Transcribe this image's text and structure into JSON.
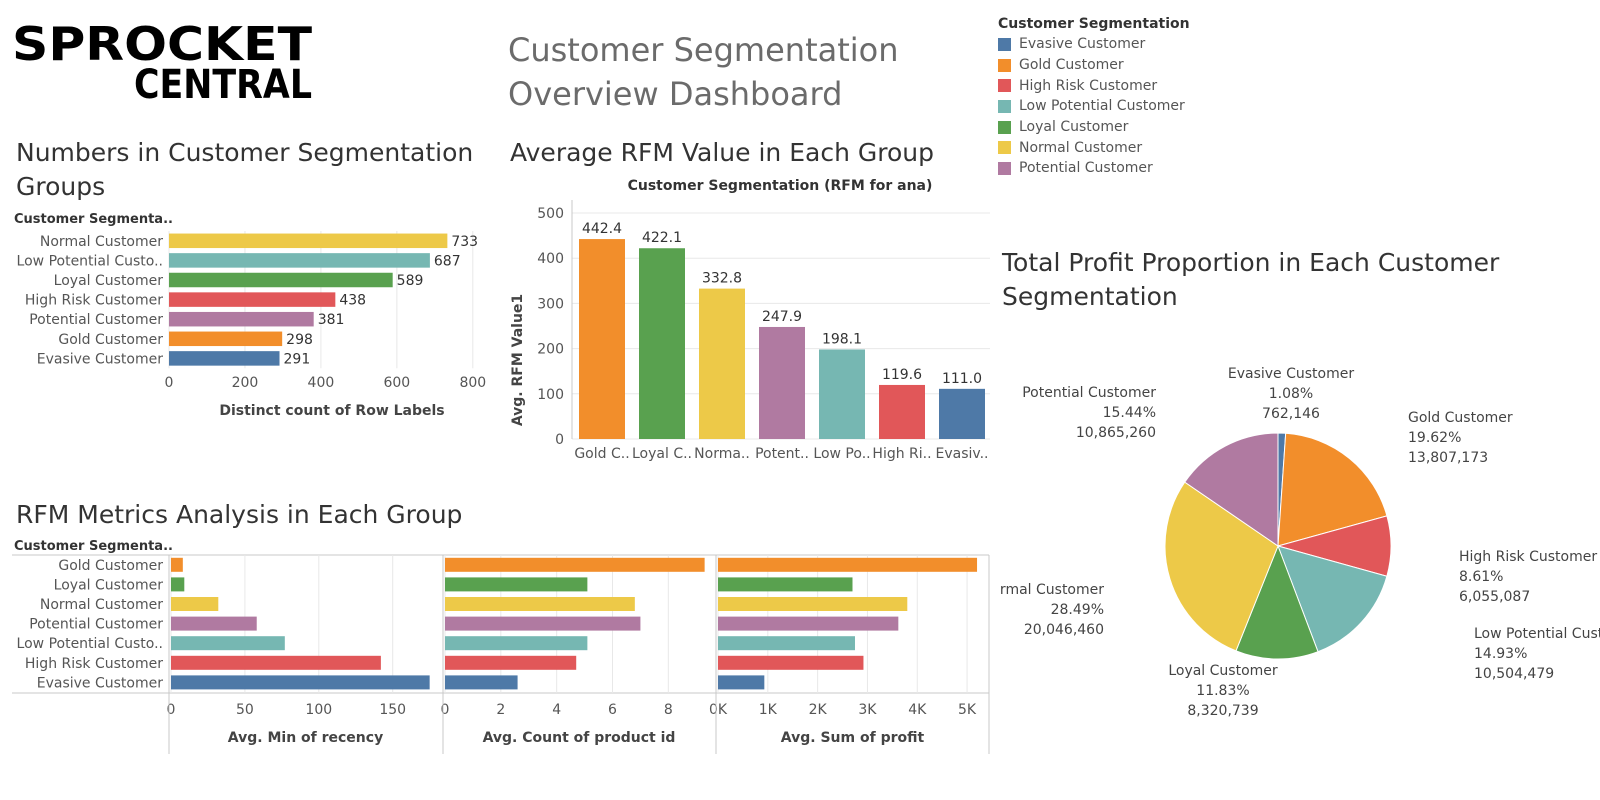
{
  "logo": {
    "line1": "SPROCKET",
    "line2": "CENTRAL"
  },
  "dashboard_title": "Customer Segmentation Overview Dashboard",
  "section_titles": {
    "counts": "Numbers in Customer Segmentation Groups",
    "avg_rfm": "Average RFM Value in Each Group",
    "profit": "Total Profit Proportion in Each Customer Segmentation",
    "metrics": "RFM Metrics Analysis in Each Group"
  },
  "legend": {
    "title": "Customer Segmentation",
    "items": [
      {
        "label": "Evasive Customer",
        "color": "#4e79a7"
      },
      {
        "label": "Gold Customer",
        "color": "#f28e2b"
      },
      {
        "label": "High Risk Customer",
        "color": "#e15759"
      },
      {
        "label": "Low Potential Customer",
        "color": "#76b7b2"
      },
      {
        "label": "Loyal Customer",
        "color": "#59a14f"
      },
      {
        "label": "Normal Customer",
        "color": "#edc948"
      },
      {
        "label": "Potential Customer",
        "color": "#b07aa1"
      }
    ]
  },
  "chart_data": [
    {
      "id": "counts",
      "type": "bar",
      "orientation": "horizontal",
      "row_header": "Customer Segmenta..",
      "categories": [
        "Normal Customer",
        "Low Potential Custo..",
        "Loyal Customer",
        "High Risk Customer",
        "Potential Customer",
        "Gold Customer",
        "Evasive Customer"
      ],
      "values": [
        733,
        687,
        589,
        438,
        381,
        298,
        291
      ],
      "colors": [
        "#edc948",
        "#76b7b2",
        "#59a14f",
        "#e15759",
        "#b07aa1",
        "#f28e2b",
        "#4e79a7"
      ],
      "xlabel": "Distinct count of Row Labels",
      "xticks": [
        "0",
        "200",
        "400",
        "600",
        "800"
      ],
      "xlim": [
        0,
        840
      ]
    },
    {
      "id": "avg_rfm",
      "type": "bar",
      "orientation": "vertical",
      "column_header": "Customer Segmentation (RFM for ana)",
      "categories": [
        "Gold C..",
        "Loyal C..",
        "Norma..",
        "Potent..",
        "Low Po..",
        "High Ri..",
        "Evasiv.."
      ],
      "values": [
        442.4,
        422.1,
        332.8,
        247.9,
        198.1,
        119.6,
        111.0
      ],
      "value_labels": [
        "442.4",
        "422.1",
        "332.8",
        "247.9",
        "198.1",
        "119.6",
        "111.0"
      ],
      "colors": [
        "#f28e2b",
        "#59a14f",
        "#edc948",
        "#b07aa1",
        "#76b7b2",
        "#e15759",
        "#4e79a7"
      ],
      "ylabel": "Avg. RFM Value1",
      "yticks": [
        "500",
        "400",
        "300",
        "200",
        "100",
        "0"
      ],
      "ylim": [
        0,
        520
      ]
    },
    {
      "id": "profit",
      "type": "pie",
      "slices": [
        {
          "name": "Evasive Customer",
          "percent": "1.08%",
          "amount": "762,146",
          "value": 762146,
          "color": "#4e79a7"
        },
        {
          "name": "Gold Customer",
          "percent": "19.62%",
          "amount": "13,807,173",
          "value": 13807173,
          "color": "#f28e2b"
        },
        {
          "name": "High Risk Customer",
          "percent": "8.61%",
          "amount": "6,055,087",
          "value": 6055087,
          "color": "#e15759"
        },
        {
          "name": "Low Potential Customer",
          "percent": "14.93%",
          "amount": "10,504,479",
          "value": 10504479,
          "color": "#76b7b2"
        },
        {
          "name": "Loyal Customer",
          "percent": "11.83%",
          "amount": "8,320,739",
          "value": 8320739,
          "color": "#59a14f"
        },
        {
          "name": "Normal Customer",
          "percent": "28.49%",
          "amount": "20,046,460",
          "value": 20046460,
          "color": "#edc948"
        },
        {
          "name": "Potential Customer",
          "percent": "15.44%",
          "amount": "10,865,260",
          "value": 10865260,
          "color": "#b07aa1"
        }
      ]
    },
    {
      "id": "metrics",
      "type": "bar",
      "orientation": "horizontal",
      "row_header": "Customer Segmenta..",
      "categories": [
        "Gold Customer",
        "Loyal Customer",
        "Normal Customer",
        "Potential Customer",
        "Low Potential Custo..",
        "High Risk Customer",
        "Evasive Customer"
      ],
      "colors": [
        "#f28e2b",
        "#59a14f",
        "#edc948",
        "#b07aa1",
        "#76b7b2",
        "#e15759",
        "#4e79a7"
      ],
      "panels": [
        {
          "xlabel": "Avg. Min of recency",
          "values": [
            8,
            9,
            32,
            58,
            77,
            142,
            175
          ],
          "xticks": [
            "0",
            "50",
            "100",
            "150"
          ],
          "xlim": [
            0,
            182
          ]
        },
        {
          "xlabel": "Avg. Count of product id",
          "values": [
            9.3,
            5.1,
            6.8,
            7.0,
            5.1,
            4.7,
            2.6
          ],
          "xticks": [
            "0",
            "2",
            "4",
            "6",
            "8"
          ],
          "xlim": [
            0,
            9.6
          ]
        },
        {
          "xlabel": "Avg. Sum of profit",
          "values": [
            5200,
            2700,
            3800,
            3620,
            2750,
            2920,
            930
          ],
          "xticks": [
            "0K",
            "1K",
            "2K",
            "3K",
            "4K",
            "5K"
          ],
          "xtick_values": [
            0,
            1000,
            2000,
            3000,
            4000,
            5000
          ],
          "xlim": [
            0,
            5400
          ]
        }
      ]
    }
  ]
}
